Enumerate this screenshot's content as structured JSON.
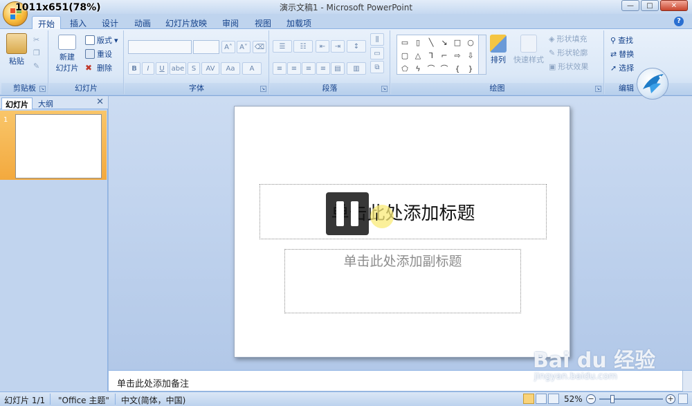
{
  "overlay": {
    "resolution_label": "1011x651(78%)"
  },
  "window": {
    "title": "演示文稿1 - Microsoft PowerPoint",
    "min": "—",
    "max": "□",
    "close": "✕"
  },
  "tabs": [
    "开始",
    "插入",
    "设计",
    "动画",
    "幻灯片放映",
    "审阅",
    "视图",
    "加载项"
  ],
  "ribbon": {
    "clipboard": {
      "label": "剪贴板",
      "paste": "粘贴"
    },
    "slides": {
      "label": "幻灯片",
      "new_slide_line1": "新建",
      "new_slide_line2": "幻灯片",
      "layout": "版式",
      "reset": "重设",
      "delete": "删除"
    },
    "font": {
      "label": "字体"
    },
    "paragraph": {
      "label": "段落"
    },
    "drawing": {
      "label": "绘图",
      "arrange": "排列",
      "quick_styles": "快速样式",
      "shape_fill": "形状填充",
      "shape_outline": "形状轮廓",
      "shape_effects": "形状效果"
    },
    "editing": {
      "label": "编辑",
      "find": "查找",
      "replace": "替换",
      "select": "选择"
    }
  },
  "left_pane": {
    "tab_slides": "幻灯片",
    "tab_outline": "大纲",
    "close": "✕",
    "thumb_number": "1"
  },
  "slide": {
    "title_placeholder": "单击此处添加标题",
    "subtitle_placeholder": "单击此处添加副标题"
  },
  "notes": {
    "placeholder": "单击此处添加备注"
  },
  "watermark": {
    "main": "Bai du 经验",
    "sub": "jingyan.baidu.com"
  },
  "status": {
    "slide_info": "幻灯片 1/1",
    "theme": "\"Office 主题\"",
    "language": "中文(简体，中国)",
    "zoom": "52%",
    "zoom_minus": "−",
    "zoom_plus": "+"
  },
  "colors": {
    "ribbon_text": "#15428b",
    "selection": "#f3a93e",
    "slide_bg": "#ffffff"
  }
}
